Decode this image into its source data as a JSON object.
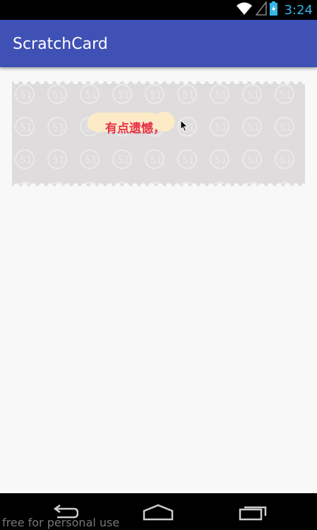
{
  "status_bar": {
    "time": "3:24",
    "icons": [
      "wifi-icon",
      "signal-icon",
      "battery-charging-icon"
    ]
  },
  "app_bar": {
    "title": "ScratchCard",
    "color": "#3f51b5"
  },
  "scratch_card": {
    "revealed_text": "有点遗憾，",
    "cover_color": "#dedcdc",
    "text_color": "#e8304a",
    "reveal_bg": "#fdebc8"
  },
  "nav_bar": {
    "buttons": [
      "back-icon",
      "home-icon",
      "recent-apps-icon"
    ]
  },
  "watermark": "free for personal use"
}
